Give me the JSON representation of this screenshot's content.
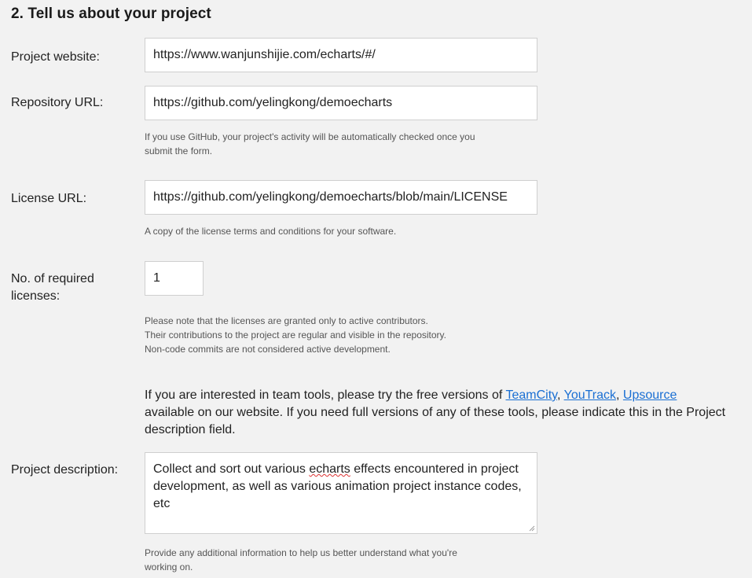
{
  "section": {
    "title": "2. Tell us about your project"
  },
  "website": {
    "label": "Project website:",
    "value": "https://www.wanjunshijie.com/echarts/#/"
  },
  "repository": {
    "label": "Repository URL:",
    "value": "https://github.com/yelingkong/demoecharts",
    "hint_line1": "If you use GitHub, your project's activity will be automatically checked once you",
    "hint_line2": "submit the form."
  },
  "license": {
    "label": "License URL:",
    "value": "https://github.com/yelingkong/demoecharts/blob/main/LICENSE",
    "hint": "A copy of the license terms and conditions for your software."
  },
  "licenses_count": {
    "label_line1": "No. of required",
    "label_line2": "licenses:",
    "value": "1",
    "hint_line1": "Please note that the licenses are granted only to active contributors.",
    "hint_line2": "Their contributions to the project are regular and visible in the repository.",
    "hint_line3": "Non-code commits are not considered active development."
  },
  "tools_note": {
    "prefix": "If you are interested in team tools, please try the free versions of ",
    "link1": "TeamCity",
    "sep1": ", ",
    "link2": "YouTrack",
    "sep2": ", ",
    "link3": "Upsource",
    "suffix": " available on our website. If you need full versions of any of these tools, please indicate this in the Project description field."
  },
  "description": {
    "label": "Project description:",
    "text_before": "Collect and sort out various ",
    "misspelled": "echarts",
    "text_after": " effects encountered in project development, as well as various animation project instance codes, etc",
    "hint_line1": "Provide any additional information to help us better understand what you're",
    "hint_line2": "working on."
  },
  "icons": {
    "resize": "resize-grip-icon"
  },
  "colors": {
    "link": "#1a6fd3",
    "background": "#f2f2f2",
    "border": "#cfcfcf"
  }
}
